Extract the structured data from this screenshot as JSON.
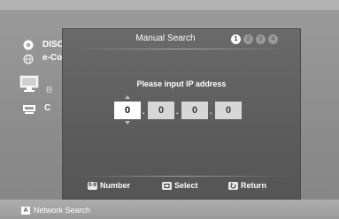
{
  "background": {
    "items": [
      {
        "label": "DISC",
        "icon": "disc-icon"
      },
      {
        "label": "e-Co",
        "icon": "globe-icon"
      },
      {
        "label": "B",
        "icon": "monitor-icon"
      },
      {
        "label": "C",
        "icon": "device-icon"
      }
    ]
  },
  "dialog": {
    "title": "Manual Search",
    "steps": [
      "1",
      "2",
      "3",
      "4"
    ],
    "active_step": 1,
    "prompt": "Please input IP address",
    "ip": [
      "0",
      "0",
      "0",
      "0"
    ],
    "separator": "."
  },
  "legend": {
    "number_key": "0-9",
    "number": "Number",
    "select": "Select",
    "return": "Return"
  },
  "bottom": {
    "key": "A",
    "label": "Network Search"
  },
  "colors": {
    "dialog": "#5e5e5e",
    "screen": "#939393",
    "active_field": "#ffffff"
  }
}
